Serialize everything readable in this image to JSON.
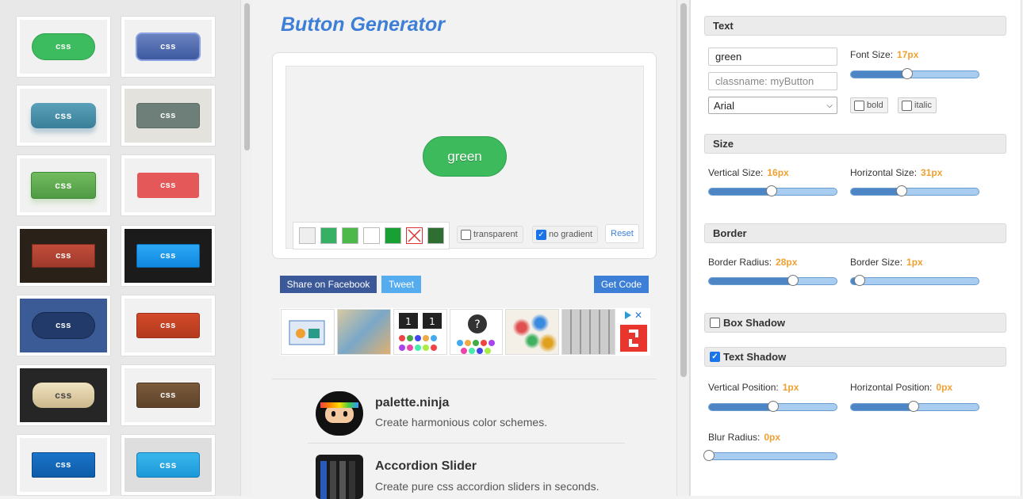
{
  "gallery": {
    "button_label": "css"
  },
  "app": {
    "title": "Button Generator"
  },
  "preview": {
    "button_text": "green"
  },
  "swatch_colors": [
    "#eeeeee",
    "#36b065",
    "#4cb948",
    "#ffffff",
    "#18a034",
    "x",
    "#2e6e32"
  ],
  "options": {
    "transparent": "transparent",
    "no_gradient": "no gradient",
    "reset": "Reset"
  },
  "actions": {
    "facebook": "Share on Facebook",
    "tweet": "Tweet",
    "get_code": "Get Code"
  },
  "promos": [
    {
      "title": "palette.ninja",
      "desc": "Create harmonious color schemes."
    },
    {
      "title": "Accordion Slider",
      "desc": "Create pure css accordion sliders in seconds."
    }
  ],
  "panel": {
    "text_section": "Text",
    "text_value": "green",
    "classname_placeholder": "classname: myButton",
    "font": "Arial",
    "font_size_label": "Font Size:",
    "font_size": "17px",
    "bold": "bold",
    "italic": "italic",
    "size_section": "Size",
    "vsize_label": "Vertical Size:",
    "vsize": "16px",
    "hsize_label": "Horizontal Size:",
    "hsize": "31px",
    "border_section": "Border",
    "radius_label": "Border Radius:",
    "radius": "28px",
    "bsize_label": "Border Size:",
    "bsize": "1px",
    "box_shadow": "Box Shadow",
    "text_shadow": "Text Shadow",
    "vpos_label": "Vertical Position:",
    "vpos": "1px",
    "hpos_label": "Horizontal Position:",
    "hpos": "0px",
    "blur_label": "Blur Radius:",
    "blur": "0px"
  }
}
